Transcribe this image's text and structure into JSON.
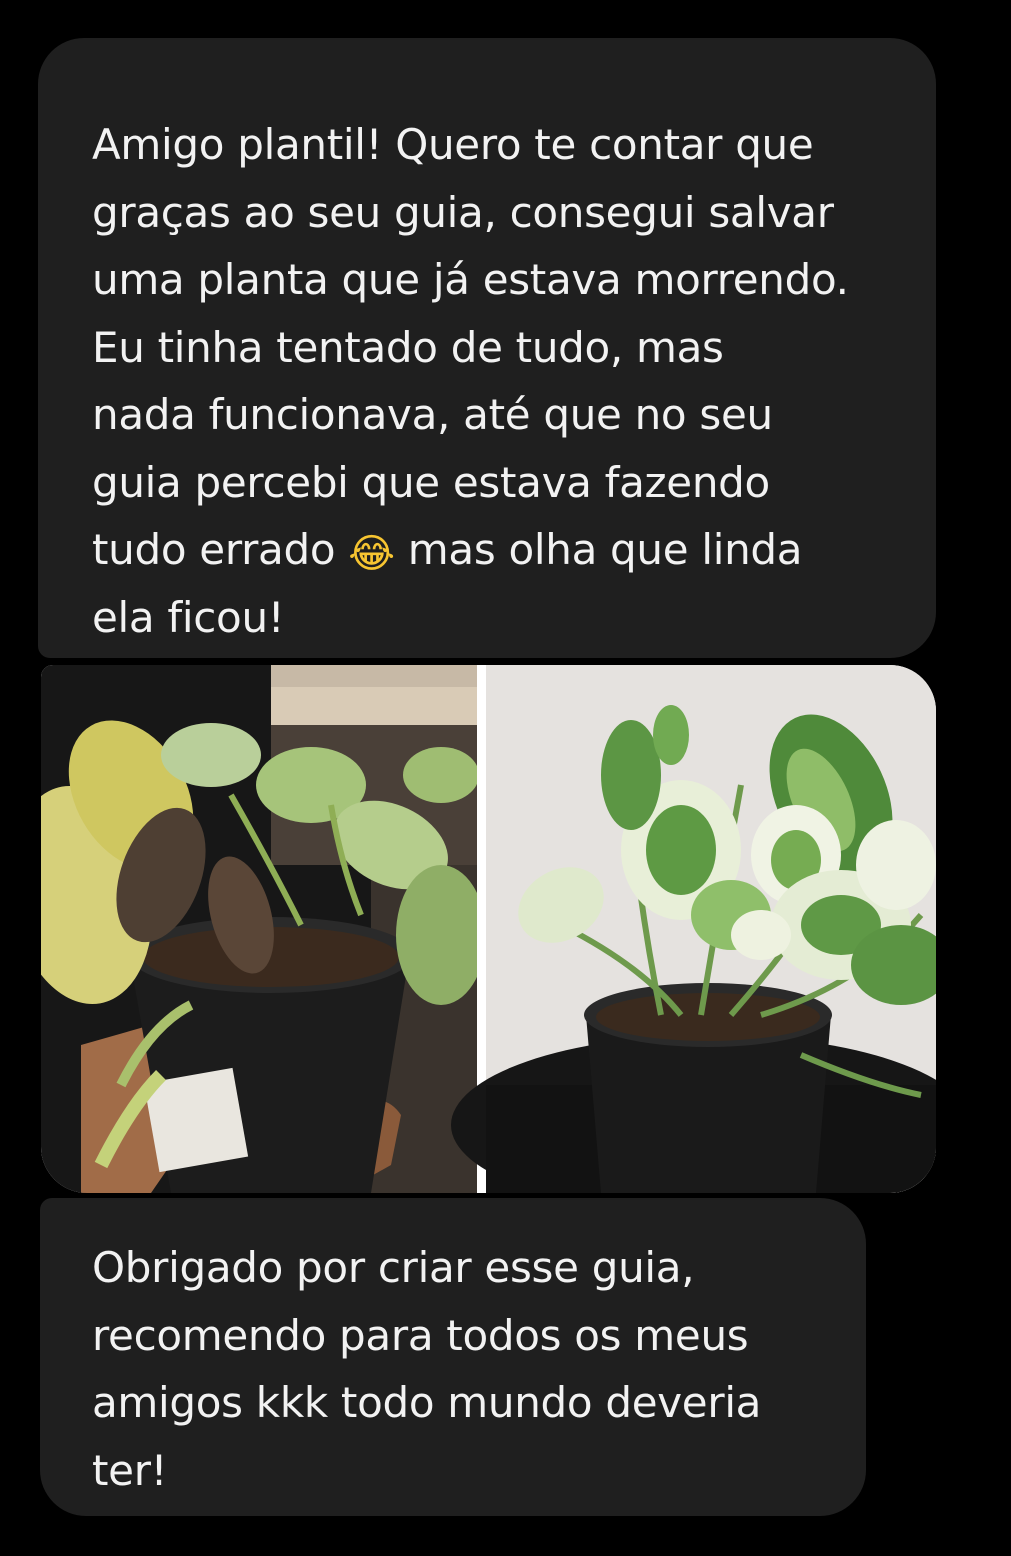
{
  "messages": [
    {
      "text": "Amigo plantil! Quero te contar que\ngraças ao seu guia, consegui salvar\numa planta que já estava morrendo.\nEu tinha tentado de tudo, mas\nnada funcionava, até que no seu\nguia percebi que estava fazendo\ntudo errado",
      "emoji": "😂",
      "text_after_emoji": " mas olha que linda\nela ficou!"
    },
    {
      "photos": [
        {
          "subject": "before-plant"
        },
        {
          "subject": "after-plant"
        }
      ]
    },
    {
      "text": "Obrigado por criar esse guia,\nrecomendo para todos os meus\namigos kkk todo mundo deveria\nter!"
    }
  ],
  "colors": {
    "background": "#000000",
    "bubble": "#1f1f1f",
    "text": "#f2f2f2"
  }
}
